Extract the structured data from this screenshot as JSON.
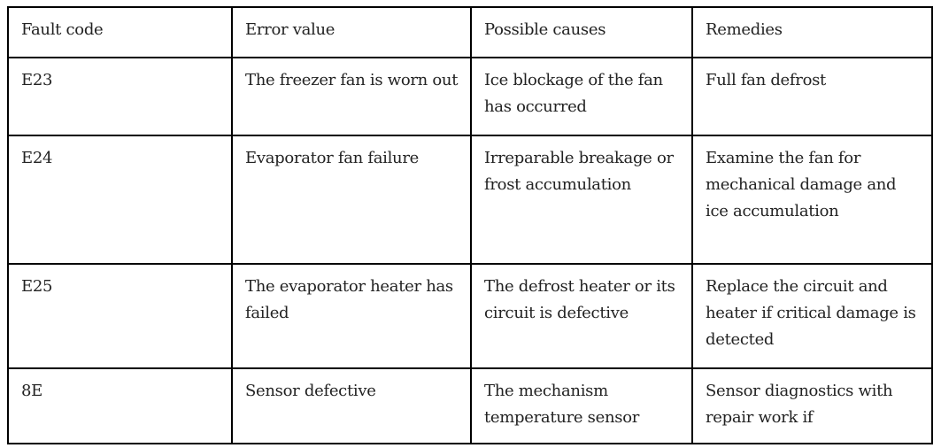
{
  "table": {
    "headers": [
      "Fault code",
      "Error value",
      "Possible causes",
      "Remedies"
    ],
    "rows": [
      [
        "E23",
        "The freezer fan is worn out",
        "Ice blockage of the fan has occurred",
        "Full fan defrost"
      ],
      [
        "E24",
        "Evaporator fan failure",
        "Irreparable breakage or frost accumulation",
        "Examine the fan for mechanical damage and ice accumulation"
      ],
      [
        "E25",
        "The evaporator heater has failed",
        "The defrost heater or its circuit is defective",
        "Replace the circuit and heater if critical damage is detected"
      ],
      [
        "8E",
        "Sensor defective",
        "The mechanism temperature sensor",
        "Sensor diagnostics with repair work if"
      ]
    ]
  }
}
